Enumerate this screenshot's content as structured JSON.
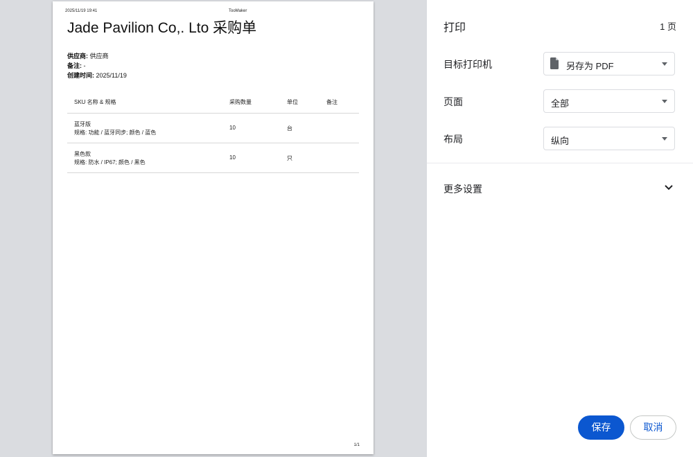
{
  "preview": {
    "header_date": "2025/11/19 19:41",
    "header_app": "TooMaker",
    "doc_title": "Jade Pavilion Co,. Lto 采购单",
    "meta": [
      {
        "key": "供应商:",
        "value": " 供应商"
      },
      {
        "key": "备注:",
        "value": " -"
      },
      {
        "key": "创建时间:",
        "value": " 2025/11/19"
      }
    ],
    "table": {
      "headers": [
        "SKU 名称 & 规格",
        "采购数量",
        "单位",
        "备注"
      ],
      "rows": [
        {
          "name": "蓝牙版",
          "spec": "规格: 功能 / 蓝牙同步; 颜色 / 蓝色",
          "qty": "10",
          "unit": "台",
          "note": ""
        },
        {
          "name": "黑色款",
          "spec": "规格: 防水 / IP67; 颜色 / 黑色",
          "qty": "10",
          "unit": "只",
          "note": ""
        }
      ]
    },
    "page_number": "1/1"
  },
  "panel": {
    "title": "打印",
    "page_count": "1 页",
    "printer_label": "目标打印机",
    "printer_value": "另存为 PDF",
    "pages_label": "页面",
    "pages_value": "全部",
    "layout_label": "布局",
    "layout_value": "纵向",
    "more_settings": "更多设置",
    "save_button": "保存",
    "cancel_button": "取消"
  },
  "icons": {
    "printer_icon": "file-icon",
    "expand_icon": "chevron-down-icon"
  },
  "colors": {
    "accent": "#0b57d0",
    "preview_bg": "#dadce0"
  }
}
